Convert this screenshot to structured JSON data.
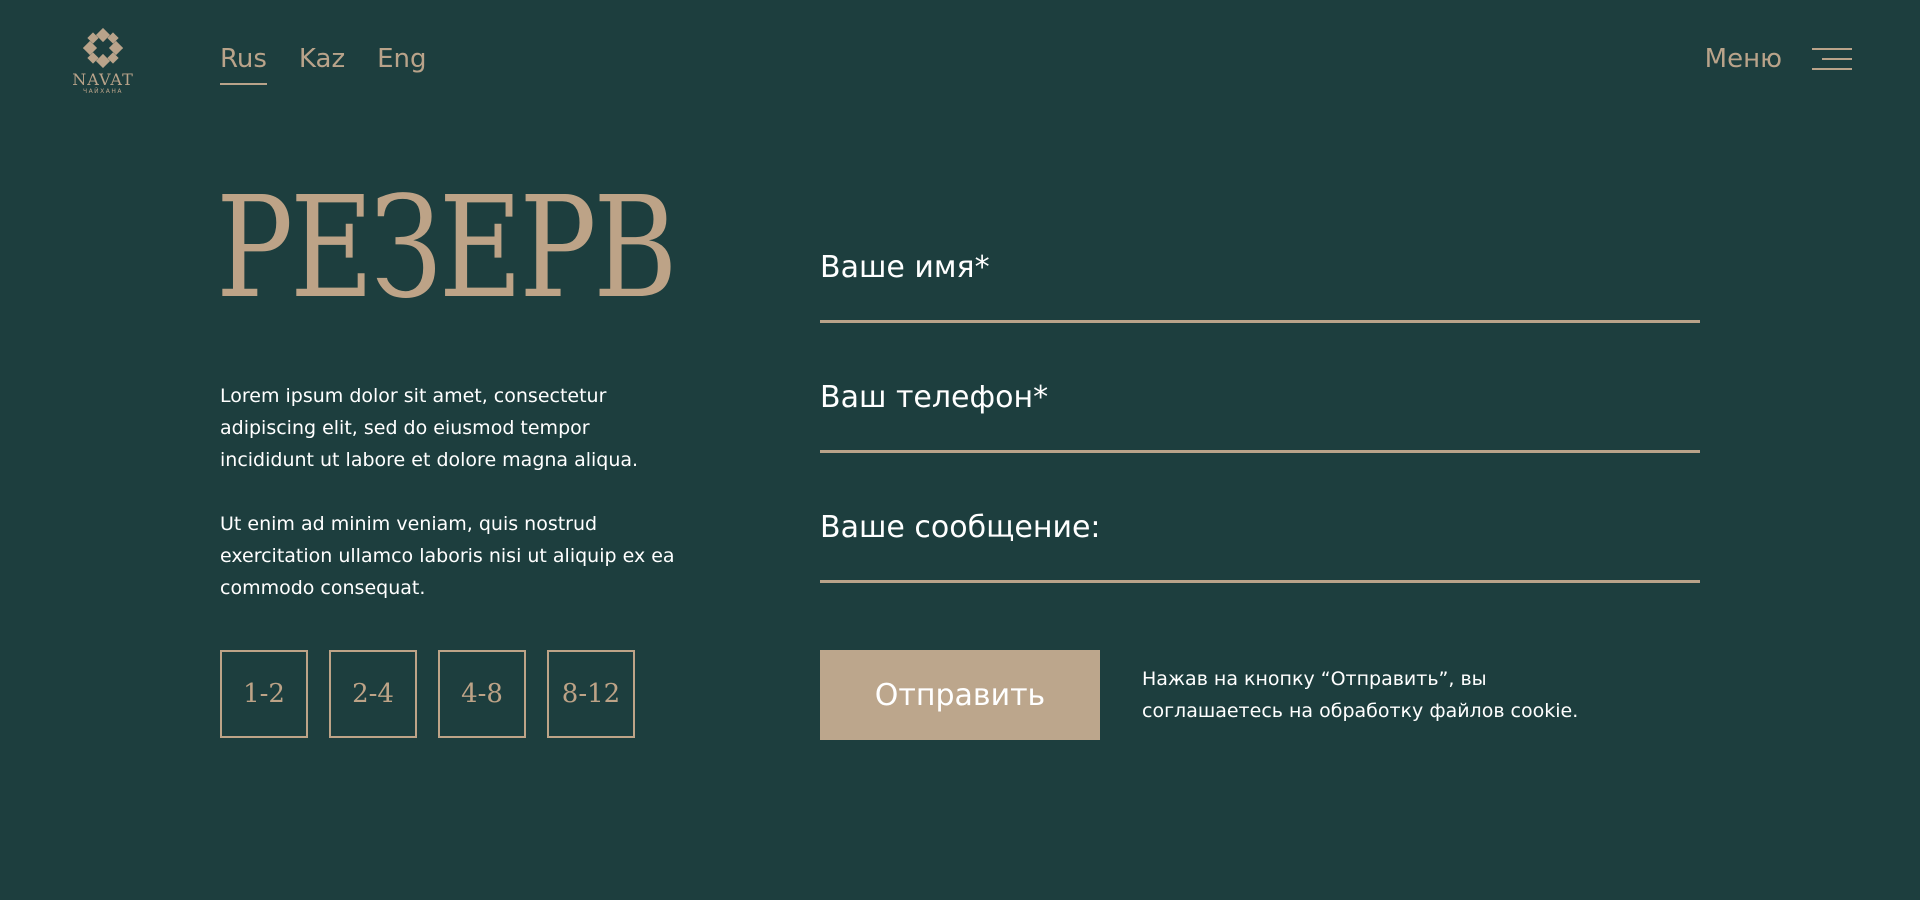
{
  "logo": {
    "name": "NAVAT",
    "subtitle": "ЧАЙХАНА"
  },
  "languages": [
    {
      "label": "Rus",
      "active": true
    },
    {
      "label": "Kaz",
      "active": false
    },
    {
      "label": "Eng",
      "active": false
    }
  ],
  "menu": {
    "label": "Меню",
    "icon": "hamburger-icon"
  },
  "page": {
    "title": "РЕЗЕРВ",
    "paragraphs": [
      "Lorem ipsum dolor sit amet, consectetur adipiscing elit, sed do eiusmod tempor incididunt ut labore et dolore magna aliqua.",
      "Ut enim ad minim veniam, quis nostrud exercitation ullamco laboris nisi ut aliquip ex ea commodo consequat."
    ]
  },
  "guests": [
    "1-2",
    "2-4",
    "4-8",
    "8-12"
  ],
  "form": {
    "name_label": "Ваше имя*",
    "phone_label": "Ваш телефон*",
    "message_label": "Ваше сообщение:",
    "submit_label": "Отправить",
    "consent_text": "Нажав на кнопку “Отправить”, вы соглашаетесь на обработку файлов cookie."
  },
  "colors": {
    "background": "#1d3e3e",
    "accent": "#bda387",
    "text": "#ffffff"
  }
}
